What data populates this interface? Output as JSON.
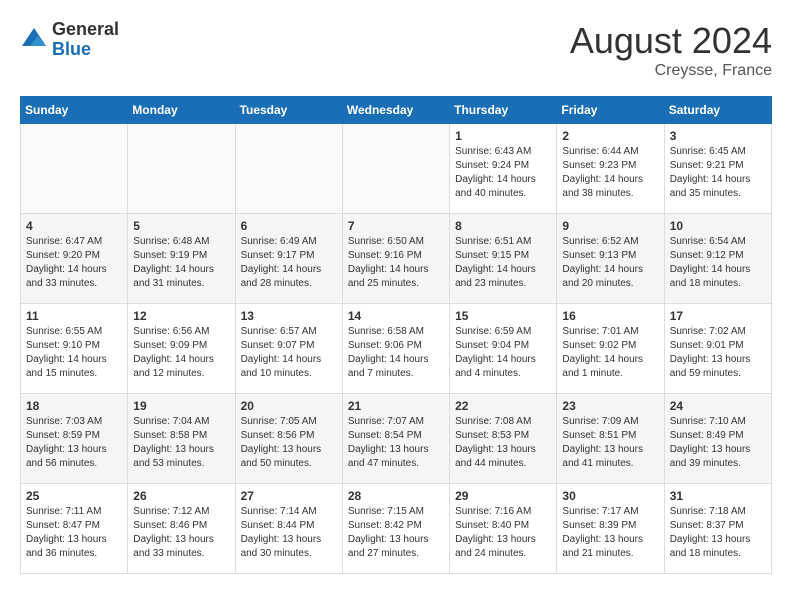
{
  "logo": {
    "general": "General",
    "blue": "Blue"
  },
  "title": {
    "month_year": "August 2024",
    "location": "Creysse, France"
  },
  "headers": [
    "Sunday",
    "Monday",
    "Tuesday",
    "Wednesday",
    "Thursday",
    "Friday",
    "Saturday"
  ],
  "weeks": [
    [
      {
        "day": "",
        "content": ""
      },
      {
        "day": "",
        "content": ""
      },
      {
        "day": "",
        "content": ""
      },
      {
        "day": "",
        "content": ""
      },
      {
        "day": "1",
        "content": "Sunrise: 6:43 AM\nSunset: 9:24 PM\nDaylight: 14 hours and 40 minutes."
      },
      {
        "day": "2",
        "content": "Sunrise: 6:44 AM\nSunset: 9:23 PM\nDaylight: 14 hours and 38 minutes."
      },
      {
        "day": "3",
        "content": "Sunrise: 6:45 AM\nSunset: 9:21 PM\nDaylight: 14 hours and 35 minutes."
      }
    ],
    [
      {
        "day": "4",
        "content": "Sunrise: 6:47 AM\nSunset: 9:20 PM\nDaylight: 14 hours and 33 minutes."
      },
      {
        "day": "5",
        "content": "Sunrise: 6:48 AM\nSunset: 9:19 PM\nDaylight: 14 hours and 31 minutes."
      },
      {
        "day": "6",
        "content": "Sunrise: 6:49 AM\nSunset: 9:17 PM\nDaylight: 14 hours and 28 minutes."
      },
      {
        "day": "7",
        "content": "Sunrise: 6:50 AM\nSunset: 9:16 PM\nDaylight: 14 hours and 25 minutes."
      },
      {
        "day": "8",
        "content": "Sunrise: 6:51 AM\nSunset: 9:15 PM\nDaylight: 14 hours and 23 minutes."
      },
      {
        "day": "9",
        "content": "Sunrise: 6:52 AM\nSunset: 9:13 PM\nDaylight: 14 hours and 20 minutes."
      },
      {
        "day": "10",
        "content": "Sunrise: 6:54 AM\nSunset: 9:12 PM\nDaylight: 14 hours and 18 minutes."
      }
    ],
    [
      {
        "day": "11",
        "content": "Sunrise: 6:55 AM\nSunset: 9:10 PM\nDaylight: 14 hours and 15 minutes."
      },
      {
        "day": "12",
        "content": "Sunrise: 6:56 AM\nSunset: 9:09 PM\nDaylight: 14 hours and 12 minutes."
      },
      {
        "day": "13",
        "content": "Sunrise: 6:57 AM\nSunset: 9:07 PM\nDaylight: 14 hours and 10 minutes."
      },
      {
        "day": "14",
        "content": "Sunrise: 6:58 AM\nSunset: 9:06 PM\nDaylight: 14 hours and 7 minutes."
      },
      {
        "day": "15",
        "content": "Sunrise: 6:59 AM\nSunset: 9:04 PM\nDaylight: 14 hours and 4 minutes."
      },
      {
        "day": "16",
        "content": "Sunrise: 7:01 AM\nSunset: 9:02 PM\nDaylight: 14 hours and 1 minute."
      },
      {
        "day": "17",
        "content": "Sunrise: 7:02 AM\nSunset: 9:01 PM\nDaylight: 13 hours and 59 minutes."
      }
    ],
    [
      {
        "day": "18",
        "content": "Sunrise: 7:03 AM\nSunset: 8:59 PM\nDaylight: 13 hours and 56 minutes."
      },
      {
        "day": "19",
        "content": "Sunrise: 7:04 AM\nSunset: 8:58 PM\nDaylight: 13 hours and 53 minutes."
      },
      {
        "day": "20",
        "content": "Sunrise: 7:05 AM\nSunset: 8:56 PM\nDaylight: 13 hours and 50 minutes."
      },
      {
        "day": "21",
        "content": "Sunrise: 7:07 AM\nSunset: 8:54 PM\nDaylight: 13 hours and 47 minutes."
      },
      {
        "day": "22",
        "content": "Sunrise: 7:08 AM\nSunset: 8:53 PM\nDaylight: 13 hours and 44 minutes."
      },
      {
        "day": "23",
        "content": "Sunrise: 7:09 AM\nSunset: 8:51 PM\nDaylight: 13 hours and 41 minutes."
      },
      {
        "day": "24",
        "content": "Sunrise: 7:10 AM\nSunset: 8:49 PM\nDaylight: 13 hours and 39 minutes."
      }
    ],
    [
      {
        "day": "25",
        "content": "Sunrise: 7:11 AM\nSunset: 8:47 PM\nDaylight: 13 hours and 36 minutes."
      },
      {
        "day": "26",
        "content": "Sunrise: 7:12 AM\nSunset: 8:46 PM\nDaylight: 13 hours and 33 minutes."
      },
      {
        "day": "27",
        "content": "Sunrise: 7:14 AM\nSunset: 8:44 PM\nDaylight: 13 hours and 30 minutes."
      },
      {
        "day": "28",
        "content": "Sunrise: 7:15 AM\nSunset: 8:42 PM\nDaylight: 13 hours and 27 minutes."
      },
      {
        "day": "29",
        "content": "Sunrise: 7:16 AM\nSunset: 8:40 PM\nDaylight: 13 hours and 24 minutes."
      },
      {
        "day": "30",
        "content": "Sunrise: 7:17 AM\nSunset: 8:39 PM\nDaylight: 13 hours and 21 minutes."
      },
      {
        "day": "31",
        "content": "Sunrise: 7:18 AM\nSunset: 8:37 PM\nDaylight: 13 hours and 18 minutes."
      }
    ]
  ]
}
